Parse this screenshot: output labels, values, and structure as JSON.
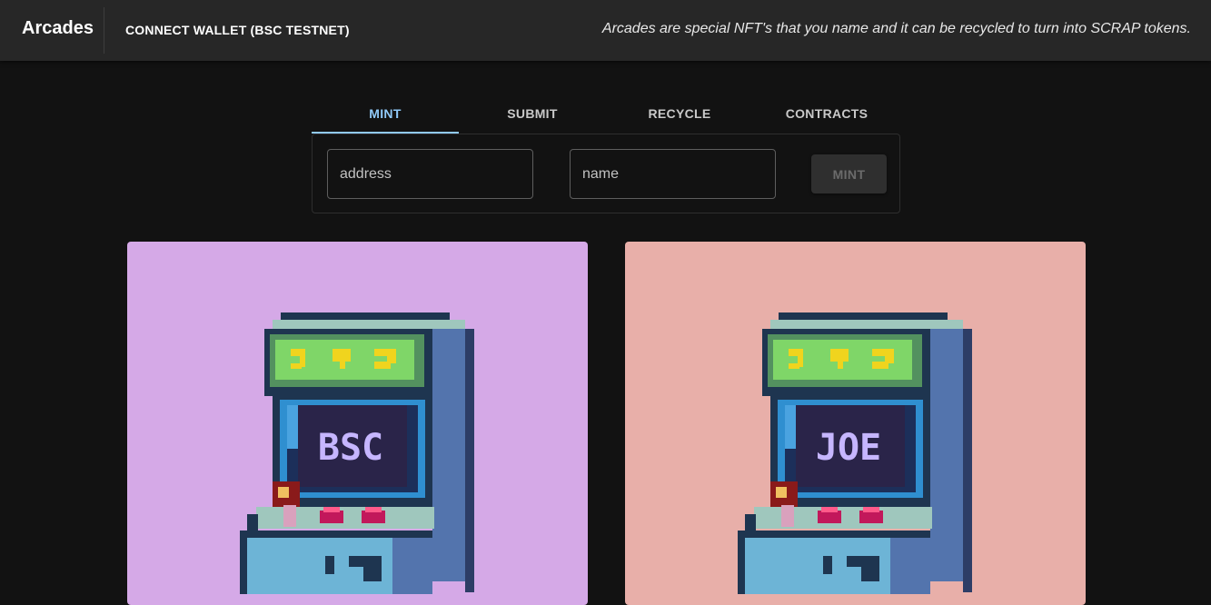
{
  "header": {
    "brand": "Arcades",
    "connect_label": "CONNECT WALLET (BSC TESTNET)",
    "tagline": "Arcades are special NFT's that you name and it can be recycled to turn into SCRAP tokens."
  },
  "tabs": [
    {
      "label": "MINT",
      "active": true
    },
    {
      "label": "SUBMIT",
      "active": false
    },
    {
      "label": "RECYCLE",
      "active": false
    },
    {
      "label": "CONTRACTS",
      "active": false
    }
  ],
  "mint_form": {
    "address_placeholder": "address",
    "address_value": "",
    "name_placeholder": "name",
    "name_value": "",
    "mint_label": "MINT"
  },
  "nfts": [
    {
      "screen_text": "BSC",
      "background": "#d5a9e7"
    },
    {
      "screen_text": "JOE",
      "background": "#e8afa9"
    }
  ],
  "colors": {
    "accent": "#90caf9",
    "appbar": "#272727",
    "background": "#121212"
  }
}
